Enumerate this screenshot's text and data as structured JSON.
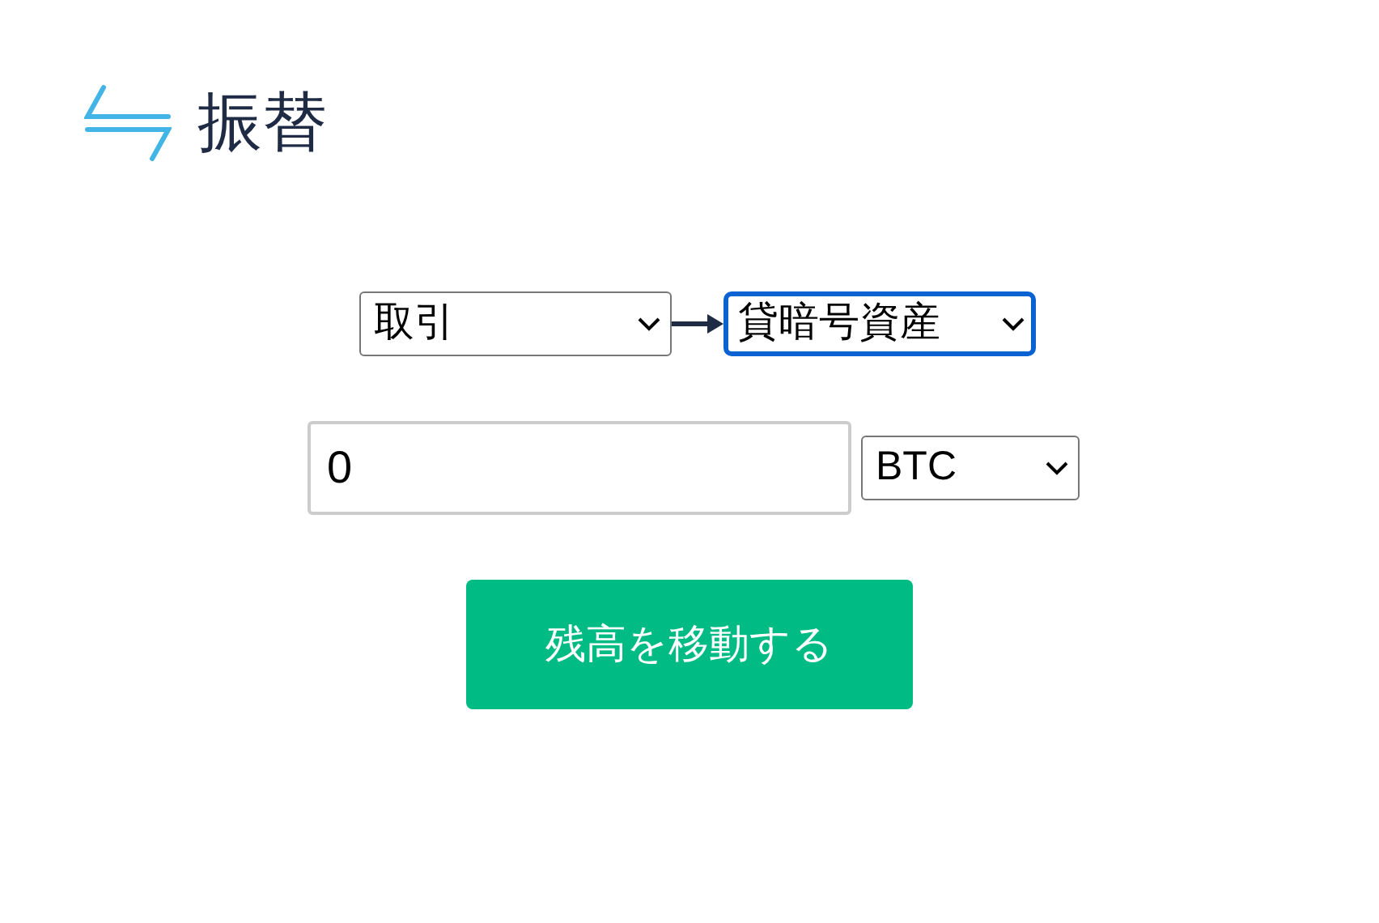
{
  "header": {
    "title": "振替"
  },
  "transfer": {
    "from": {
      "value": "取引",
      "focused": false
    },
    "to": {
      "value": "貸暗号資産",
      "focused": true
    }
  },
  "amount": {
    "value": "0"
  },
  "currency": {
    "value": "BTC",
    "focused": false
  },
  "submit_button": {
    "label": "残高を移動する"
  }
}
